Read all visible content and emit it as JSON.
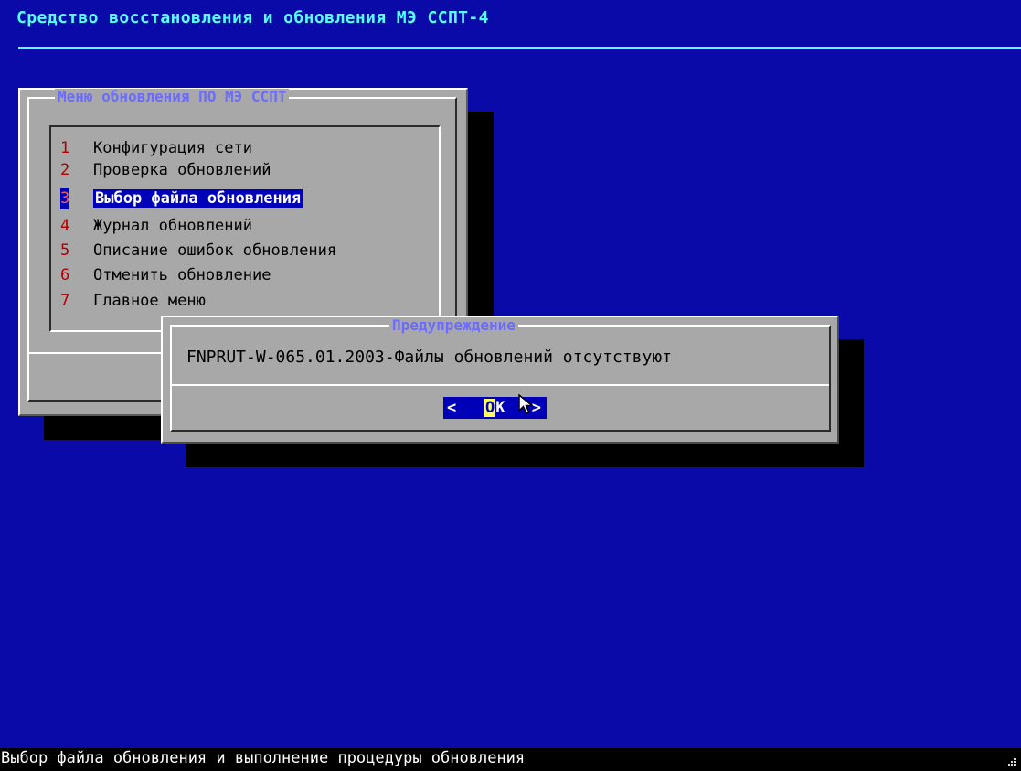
{
  "app_title": "Средство восстановления и обновления МЭ ССПТ-4",
  "menu": {
    "title": "Меню обновления ПО МЭ ССПТ",
    "items": [
      {
        "key": "1",
        "label": "Конфигурация сети"
      },
      {
        "key": "2",
        "label": "Проверка обновлений"
      },
      {
        "key": "3",
        "label": "Выбор файла обновления"
      },
      {
        "key": "4",
        "label": "Журнал обновлений"
      },
      {
        "key": "5",
        "label": "Описание ошибок обновления"
      },
      {
        "key": "6",
        "label": "Отменить обновление"
      },
      {
        "key": "7",
        "label": "Главное меню"
      }
    ],
    "selected_index": 2
  },
  "dialog": {
    "title": "Предупреждение",
    "message": "FNPRUT-W-065.01.2003-Файлы обновлений отсутствуют",
    "button": {
      "left": "<",
      "hotkey": "O",
      "rest": "K",
      "right": ">"
    }
  },
  "status_bar": {
    "text": "Выбор файла обновления и выполнение процедуры обновления"
  },
  "colors": {
    "screen_background": "#0a0aa8",
    "title_text": "#55ffff",
    "window_background": "#a8a8a8",
    "frame_title": "#6b6bff",
    "menu_key": "#b00000",
    "selection_background": "#0000b8",
    "button_hotkey": "#ffff55",
    "status_background": "#000000"
  },
  "icons": {
    "cursor": "mouse-pointer-icon",
    "status_mark": "resize-grip-icon"
  }
}
